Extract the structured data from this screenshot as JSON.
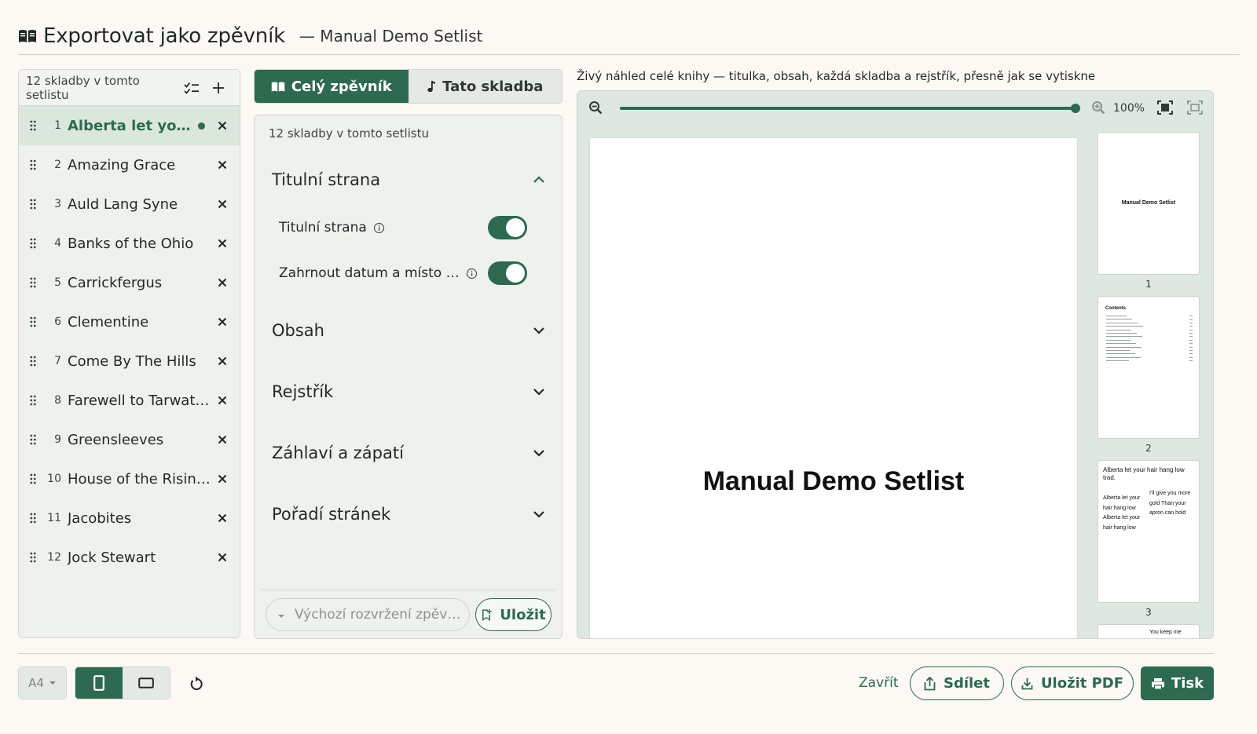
{
  "header": {
    "title": "Exportovat jako zpěvník",
    "subtitle": "— Manual Demo Setlist"
  },
  "setlist": {
    "count_label": "12 skladby v tomto setlistu",
    "songs": [
      {
        "num": "1",
        "name": "Alberta let your hair hang low",
        "active": true
      },
      {
        "num": "2",
        "name": "Amazing Grace"
      },
      {
        "num": "3",
        "name": "Auld Lang Syne"
      },
      {
        "num": "4",
        "name": "Banks of the Ohio"
      },
      {
        "num": "5",
        "name": "Carrickfergus"
      },
      {
        "num": "6",
        "name": "Clementine"
      },
      {
        "num": "7",
        "name": "Come By The Hills"
      },
      {
        "num": "8",
        "name": "Farewell to Tarwathie"
      },
      {
        "num": "9",
        "name": "Greensleeves"
      },
      {
        "num": "10",
        "name": "House of the Rising Sun"
      },
      {
        "num": "11",
        "name": "Jacobites"
      },
      {
        "num": "12",
        "name": "Jock Stewart"
      }
    ]
  },
  "tabs": {
    "whole": "Celý zpěvník",
    "single": "Tato skladba"
  },
  "options": {
    "count_label": "12 skladby v tomto setlistu",
    "sections": {
      "title_page": "Titulní strana",
      "contents": "Obsah",
      "index": "Rejstřík",
      "header_footer": "Záhlaví a zápatí",
      "page_order": "Pořadí stránek"
    },
    "title_page_toggle": "Titulní strana",
    "date_place_toggle": "Zahrnout datum a místo …",
    "layout_placeholder": "Výchozí rozvržení zpěvníku",
    "save_label": "Uložit"
  },
  "preview": {
    "caption": "Živý náhled celé knihy — titulka, obsah, každá skladba a rejstřík, přesně jak se vytiskne",
    "zoom": "100%",
    "zoom_fraction": 1.0,
    "page_title": "Manual Demo Setlist",
    "thumbs": {
      "t1_title": "Manual Demo Setlist",
      "t1_num": "1",
      "t2_heading": "Contents",
      "t2_num": "2",
      "t3_title": "Alberta let your hair hang low trad.",
      "t3_lyric_left": "Alberta let your hair hang low Alberta let your hair hang low",
      "t3_lyric_right": "I'll give you more gold Than your apron can hold",
      "t3_num": "3",
      "t4_snippet": "You keep me"
    }
  },
  "footer": {
    "paper": "A4",
    "close": "Zavřít",
    "share": "Sdílet",
    "save_pdf": "Uložit PDF",
    "print": "Tisk"
  },
  "colors": {
    "accent": "#2d6a4f",
    "background": "#fcf8f3",
    "panel": "#eef1ec"
  }
}
